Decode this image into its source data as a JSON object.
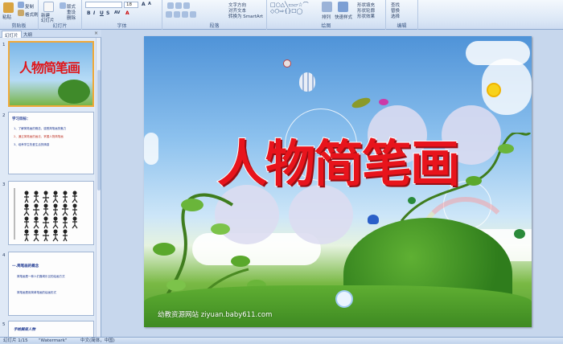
{
  "ribbon": {
    "groups": {
      "clipboard": "剪贴板",
      "slides": "幻灯片",
      "font": "字体",
      "paragraph": "段落",
      "drawing": "绘图",
      "editing": "编辑"
    },
    "paste": "粘贴",
    "copy": "复制",
    "format_painter": "格式刷",
    "new_slide": "新建\n幻灯片",
    "layout": "版式",
    "reset": "重设",
    "delete": "删除",
    "font_size": "18",
    "text_direction": "文字方向",
    "align_text": "对齐文本",
    "smartart": "转换为 SmartArt",
    "arrange": "排列",
    "quick_styles": "快速样式",
    "shape_fill": "形状填充",
    "shape_outline": "形状轮廓",
    "shape_effects": "形状效果",
    "find": "查找",
    "replace": "替换",
    "select": "选择"
  },
  "panel": {
    "tab_slides": "幻灯片",
    "tab_outline": "大纲",
    "close": "×",
    "thumbs": [
      {
        "num": "1",
        "title": "人物简笔画"
      },
      {
        "num": "2",
        "heading": "学习目标：",
        "lines": [
          "1、了解简笔画的概念，感受简笔画的魅力",
          "2、通过简笔画的画法，掌握人物简笔画",
          "3、培养学生热爱生活的情感"
        ]
      },
      {
        "num": "3"
      },
      {
        "num": "4",
        "heading": "一.简笔画的概念",
        "lines": [
          "简笔画是一种人们喜闻乐见的绘画方式",
          "简笔画是用简单笔画的绘画形式"
        ]
      },
      {
        "num": "5",
        "heading": "手绘脚底人物"
      }
    ]
  },
  "slide": {
    "title": "人物简笔画",
    "watermark": "幼教资源网站  ziyuan.baby611.com"
  },
  "status": {
    "slide_num": "幻灯片 1/15",
    "theme": "\"Watermark\"",
    "language": "中文(简体，中国)"
  },
  "colors": {
    "title_red": "#e8141c",
    "ribbon_bg": "#dbe7f6",
    "selection": "#f0a93a"
  }
}
